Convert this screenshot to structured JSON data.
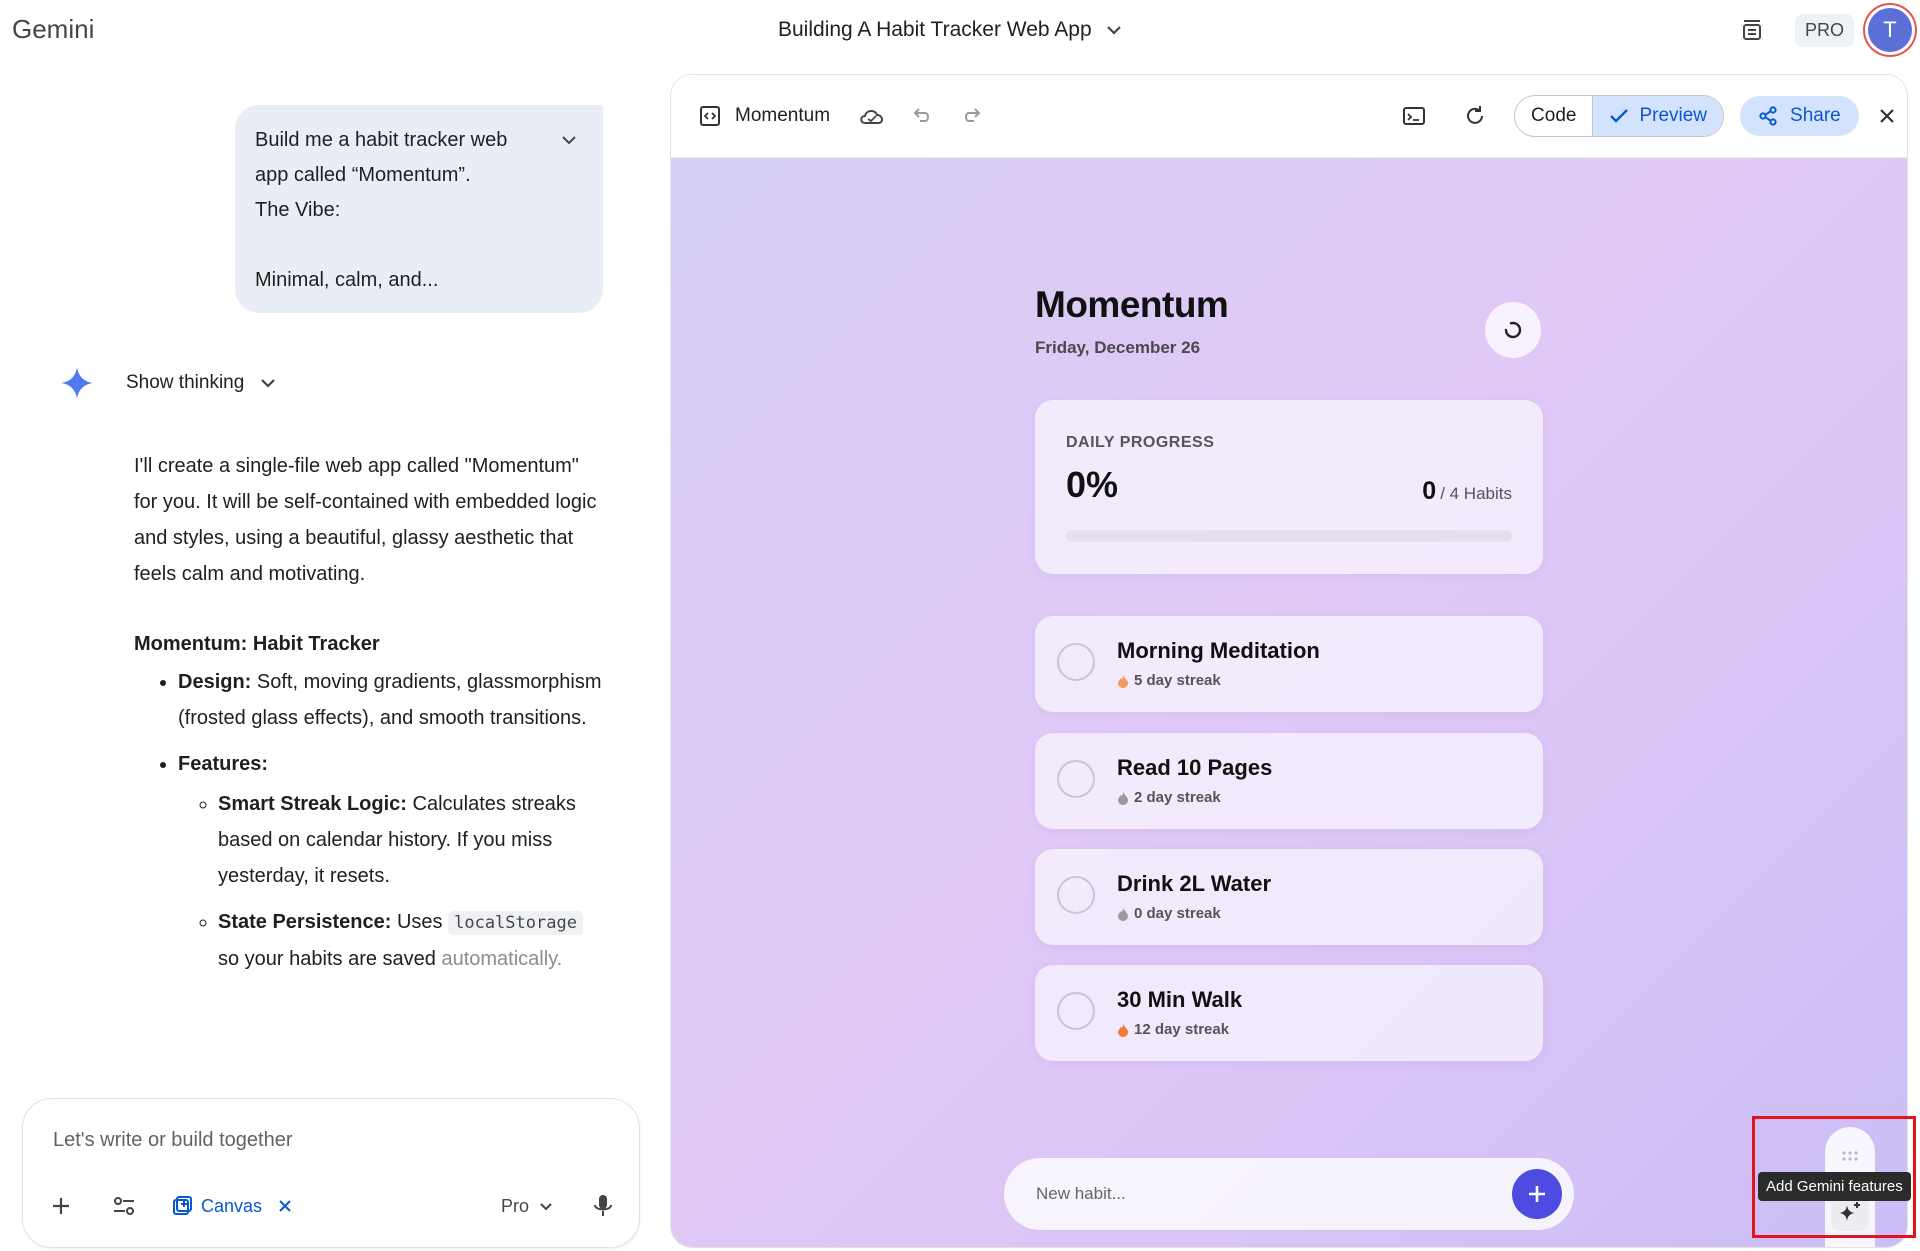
{
  "app": {
    "brand": "Gemini",
    "conversation_title": "Building A Habit Tracker Web App"
  },
  "header": {
    "plan_badge": "PRO",
    "avatar_initial": "T"
  },
  "chat": {
    "user_message": "Build me a habit tracker web app called “Momentum”.\nThe Vibe:\n\nMinimal, calm, and...",
    "thinking_label": "Show thinking",
    "answer_intro": "I'll create a single-file web app called \"Momentum\" for you. It will be self-contained with embedded logic and styles, using a beautiful, glassy aesthetic that feels calm and motivating.",
    "answer_heading": "Momentum: Habit Tracker",
    "design_label": "Design:",
    "design_text": " Soft, moving gradients, glassmorphism (frosted glass effects), and smooth transitions.",
    "features_label": "Features:",
    "streak_label": "Smart Streak Logic:",
    "streak_text": " Calculates streaks based on calendar history. If you miss yesterday, it resets.",
    "state_label": "State Persistence:",
    "state_text_1": " Uses ",
    "state_code": "localStorage",
    "state_text_2": " so your habits are saved ",
    "state_text_3": "automatically."
  },
  "composer": {
    "placeholder": "Let's write or build together",
    "canvas_label": "Canvas",
    "model_label": "Pro"
  },
  "canvas": {
    "title": "Momentum",
    "code_label": "Code",
    "preview_label": "Preview",
    "share_label": "Share"
  },
  "preview_app": {
    "title": "Momentum",
    "date": "Friday, December 26",
    "progress": {
      "label": "DAILY PROGRESS",
      "percent_text": "0%",
      "done": "0",
      "total_text": "/ 4 Habits",
      "fraction": 0
    },
    "habits": [
      {
        "name": "Morning Meditation",
        "streak": "5 day streak",
        "flame": "#f29a5e"
      },
      {
        "name": "Read 10 Pages",
        "streak": "2 day streak",
        "flame": "#9a9a9a"
      },
      {
        "name": "Drink 2L Water",
        "streak": "0 day streak",
        "flame": "#9a9a9a"
      },
      {
        "name": "30 Min Walk",
        "streak": "12 day streak",
        "flame": "#f07a3a"
      }
    ],
    "new_habit_placeholder": "New habit...",
    "accent": "#4e4ce0"
  },
  "floating_tools": {
    "tooltip": "Add Gemini features"
  }
}
